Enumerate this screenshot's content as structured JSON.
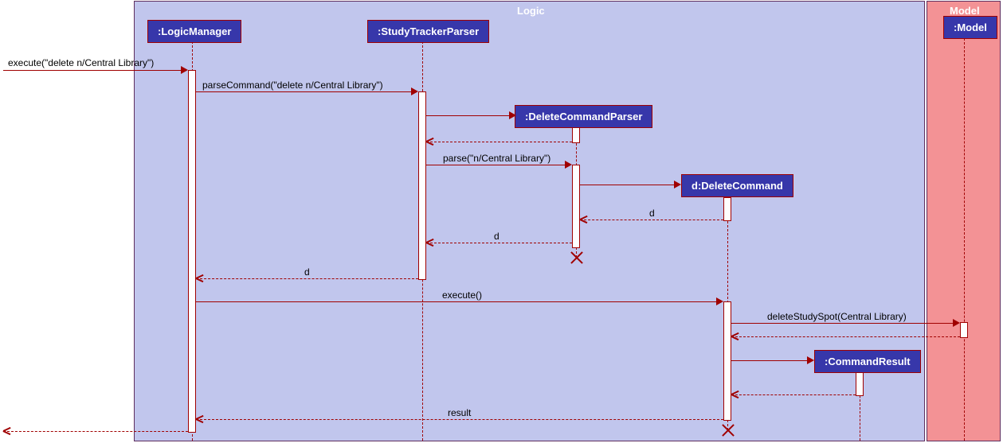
{
  "frames": {
    "logic": "Logic",
    "model": "Model"
  },
  "participants": {
    "logicManager": ":LogicManager",
    "studyTrackerParser": ":StudyTrackerParser",
    "deleteCommandParser": ":DeleteCommandParser",
    "deleteCommand": "d:DeleteCommand",
    "commandResult": ":CommandResult",
    "model": ":Model"
  },
  "messages": {
    "execute": "execute(\"delete n/Central Library\")",
    "parseCommand": "parseCommand(\"delete n/Central Library\")",
    "parse": "parse(\"n/Central Library\")",
    "d1": "d",
    "d2": "d",
    "d3": "d",
    "executeCall": "execute()",
    "deleteStudySpot": "deleteStudySpot(Central Library)",
    "result": "result"
  }
}
